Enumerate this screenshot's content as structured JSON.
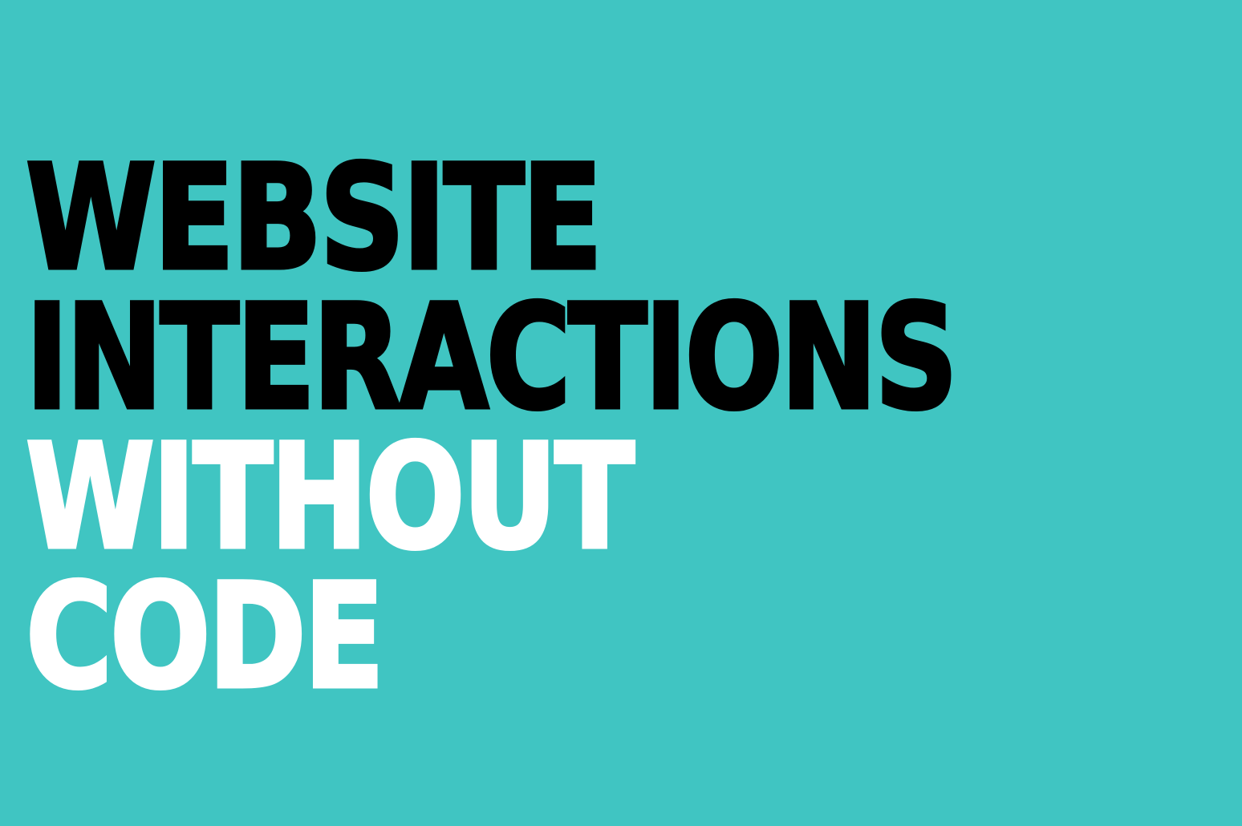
{
  "colors": {
    "background": "#40C5C2",
    "dark_text": "#000000",
    "light_text": "#FFFFFF"
  },
  "headline": {
    "line1": "WEBSITE",
    "line2": "INTERACTIONS",
    "line3": "WITHOUT",
    "line4": "CODE"
  }
}
